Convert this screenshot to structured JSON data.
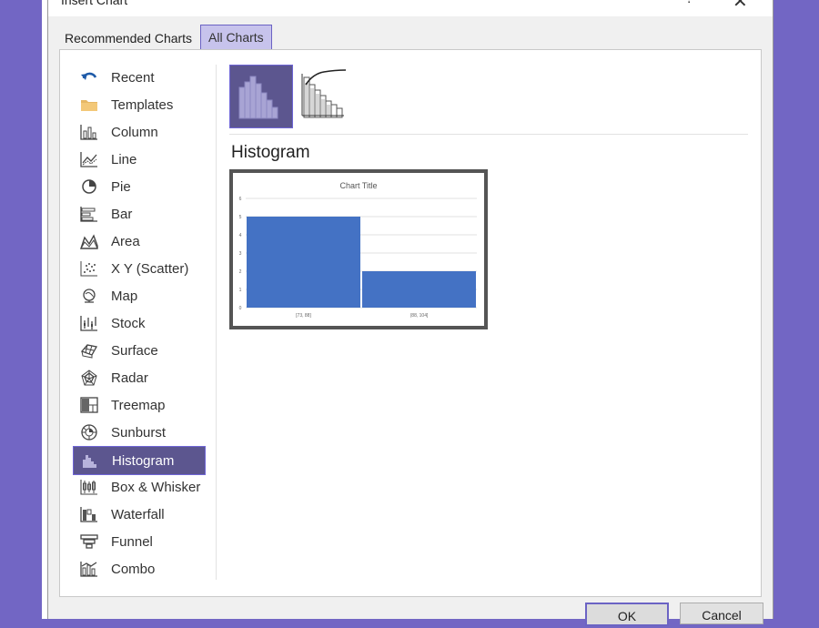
{
  "dialog": {
    "title": "Insert Chart",
    "help_glyph": "?",
    "close_glyph": "✕"
  },
  "tabs": [
    {
      "label": "Recommended Charts"
    },
    {
      "label": "All Charts"
    }
  ],
  "sidebar": {
    "items": [
      {
        "label": "Recent",
        "icon": "recent-icon"
      },
      {
        "label": "Templates",
        "icon": "folder-icon"
      },
      {
        "label": "Column",
        "icon": "column-chart-icon"
      },
      {
        "label": "Line",
        "icon": "line-chart-icon"
      },
      {
        "label": "Pie",
        "icon": "pie-chart-icon"
      },
      {
        "label": "Bar",
        "icon": "bar-chart-icon"
      },
      {
        "label": "Area",
        "icon": "area-chart-icon"
      },
      {
        "label": "X Y (Scatter)",
        "icon": "scatter-chart-icon"
      },
      {
        "label": "Map",
        "icon": "map-chart-icon"
      },
      {
        "label": "Stock",
        "icon": "stock-chart-icon"
      },
      {
        "label": "Surface",
        "icon": "surface-chart-icon"
      },
      {
        "label": "Radar",
        "icon": "radar-chart-icon"
      },
      {
        "label": "Treemap",
        "icon": "treemap-chart-icon"
      },
      {
        "label": "Sunburst",
        "icon": "sunburst-chart-icon"
      },
      {
        "label": "Histogram",
        "icon": "histogram-chart-icon",
        "selected": true
      },
      {
        "label": "Box & Whisker",
        "icon": "box-whisker-chart-icon"
      },
      {
        "label": "Waterfall",
        "icon": "waterfall-chart-icon"
      },
      {
        "label": "Funnel",
        "icon": "funnel-chart-icon"
      },
      {
        "label": "Combo",
        "icon": "combo-chart-icon"
      }
    ]
  },
  "main": {
    "subtypes": [
      {
        "name": "Histogram",
        "icon": "histogram-subtype-icon",
        "selected": true
      },
      {
        "name": "Pareto",
        "icon": "pareto-subtype-icon",
        "selected": false
      }
    ],
    "selected_chart_name": "Histogram",
    "preview": {
      "chart_data": {
        "type": "bar",
        "title": "Chart Title",
        "categories": [
          "[73, 88]",
          "(88, 104]"
        ],
        "values": [
          5,
          2
        ],
        "ylim": [
          0,
          6
        ],
        "yticks": [
          "0",
          "1",
          "2",
          "3",
          "4",
          "5",
          "6"
        ],
        "grid": true,
        "bar_color": "#4472c4"
      }
    }
  },
  "buttons": {
    "ok_label": "OK",
    "cancel_label": "Cancel"
  },
  "colors": {
    "accent": "#6b63c4",
    "selected_fill": "#5c568f",
    "background": "#7266c4"
  }
}
